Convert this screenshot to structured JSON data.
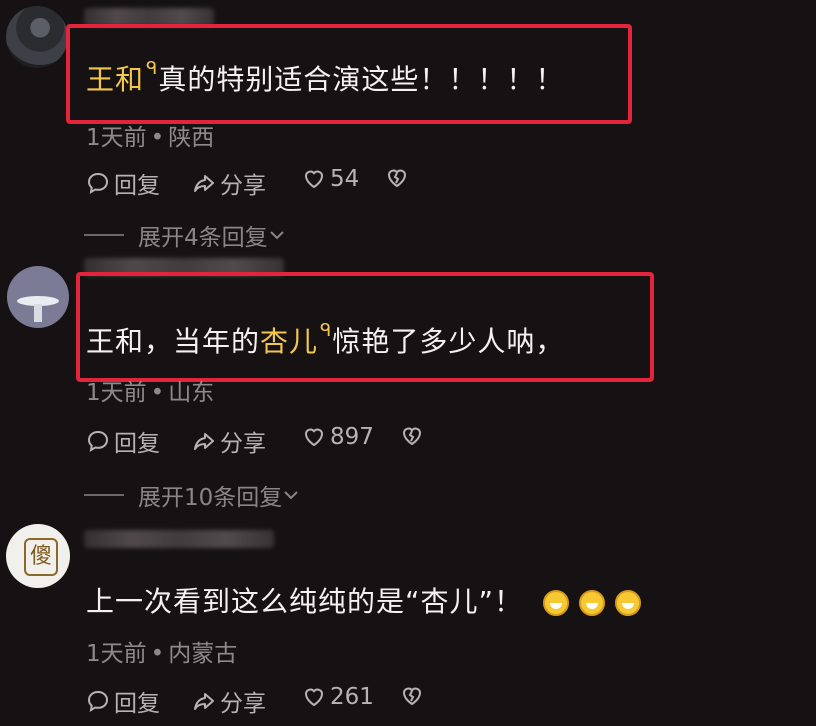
{
  "comments": [
    {
      "text_highlight": "王和",
      "text_rest": "真的特别适合演这些！！！！！",
      "meta_time": "1天前",
      "meta_location": "陕西",
      "reply_label": "回复",
      "share_label": "分享",
      "like_count": "54",
      "expand_label": "展开4条回复"
    },
    {
      "text_prefix": "王和，当年的",
      "text_highlight": "杏儿",
      "text_rest": "惊艳了多少人呐，",
      "meta_time": "1天前",
      "meta_location": "山东",
      "reply_label": "回复",
      "share_label": "分享",
      "like_count": "897",
      "expand_label": "展开10条回复"
    },
    {
      "avatar_glyph": "傻",
      "text": "上一次看到这么纯纯的是“杏儿”！",
      "meta_time": "1天前",
      "meta_location": "内蒙古",
      "reply_label": "回复",
      "share_label": "分享",
      "like_count": "261"
    }
  ],
  "colors": {
    "highlight": "#f3c64c",
    "annotation_box": "#e3243a",
    "background": "#161214"
  },
  "icons": [
    "comment-bubble-icon",
    "share-arrow-icon",
    "heart-icon",
    "broken-heart-icon",
    "chevron-down-icon",
    "search-superscript-icon",
    "grin-emoji-icon"
  ]
}
